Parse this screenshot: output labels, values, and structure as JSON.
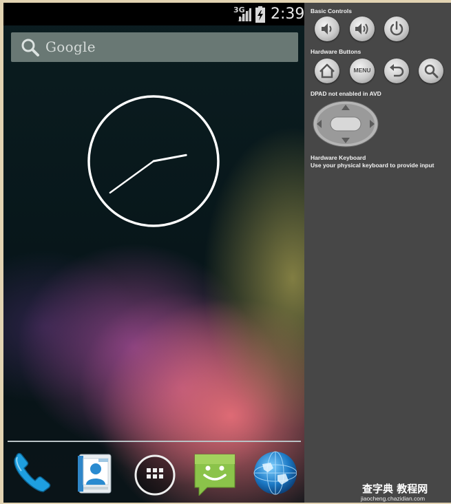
{
  "status_bar": {
    "network": "3G",
    "time": "2:39"
  },
  "search": {
    "label": "Google",
    "icon": "search-icon"
  },
  "clock_widget": {
    "hour": 2,
    "minute": 39
  },
  "dock": {
    "apps": [
      "phone-icon",
      "contacts-icon",
      "app-launcher-icon",
      "messaging-icon",
      "browser-globe-icon"
    ]
  },
  "panel": {
    "basic_controls_title": "Basic Controls",
    "hardware_buttons_title": "Hardware Buttons",
    "menu_label": "MENU",
    "dpad_title": "DPAD not enabled in AVD",
    "keyboard_title": "Hardware Keyboard",
    "keyboard_subtitle": "Use your physical keyboard to provide input"
  },
  "watermark": {
    "title": "查字典 教程网",
    "url": "jiaocheng.chazidian.com"
  },
  "colors": {
    "panel_bg": "#474747",
    "status_bar_bg": "#000000",
    "screen_bg": "#061417",
    "android_green": "#8bc34a",
    "phone_blue": "#1e9fe0"
  }
}
